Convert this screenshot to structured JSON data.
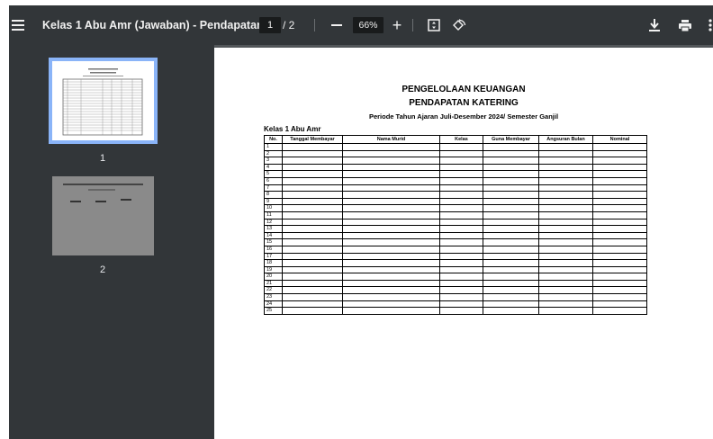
{
  "toolbar": {
    "title": "Kelas 1 Abu Amr (Jawaban) - Pendapatan ...",
    "current_page": "1",
    "page_separator": "/ 2",
    "zoom_out": "—",
    "zoom": "66%",
    "zoom_in": "+"
  },
  "icons": {
    "menu": "hamburger-icon",
    "fit": "fit-to-page-icon",
    "rotate": "rotate-icon",
    "download": "download-icon",
    "print": "print-icon",
    "more": "more-vert-icon"
  },
  "thumbnails": [
    {
      "label": "1",
      "selected": true
    },
    {
      "label": "2",
      "selected": false
    }
  ],
  "document": {
    "title1": "PENGELOLAAN KEUANGAN",
    "title2": "PENDAPATAN KATERING",
    "subtitle": "Periode Tahun Ajaran Juli-Desember 2024/ Semester Ganjil",
    "class_label": "Kelas 1 Abu Amr",
    "columns": [
      "No.",
      "Tanggal Membayar",
      "Nama Murid",
      "Kelas",
      "Guna Membayar",
      "Angsuran Bulan",
      "Nominal"
    ],
    "rows": [
      "1",
      "2",
      "3",
      "4",
      "5",
      "6",
      "7",
      "8",
      "9",
      "10",
      "11",
      "12",
      "13",
      "14",
      "15",
      "16",
      "17",
      "18",
      "19",
      "20",
      "21",
      "22",
      "23",
      "24",
      "25"
    ]
  },
  "colors": {
    "toolbar_bg": "#323639",
    "viewer_bg": "#525659",
    "thumb_selected": "#8ab4f8"
  }
}
